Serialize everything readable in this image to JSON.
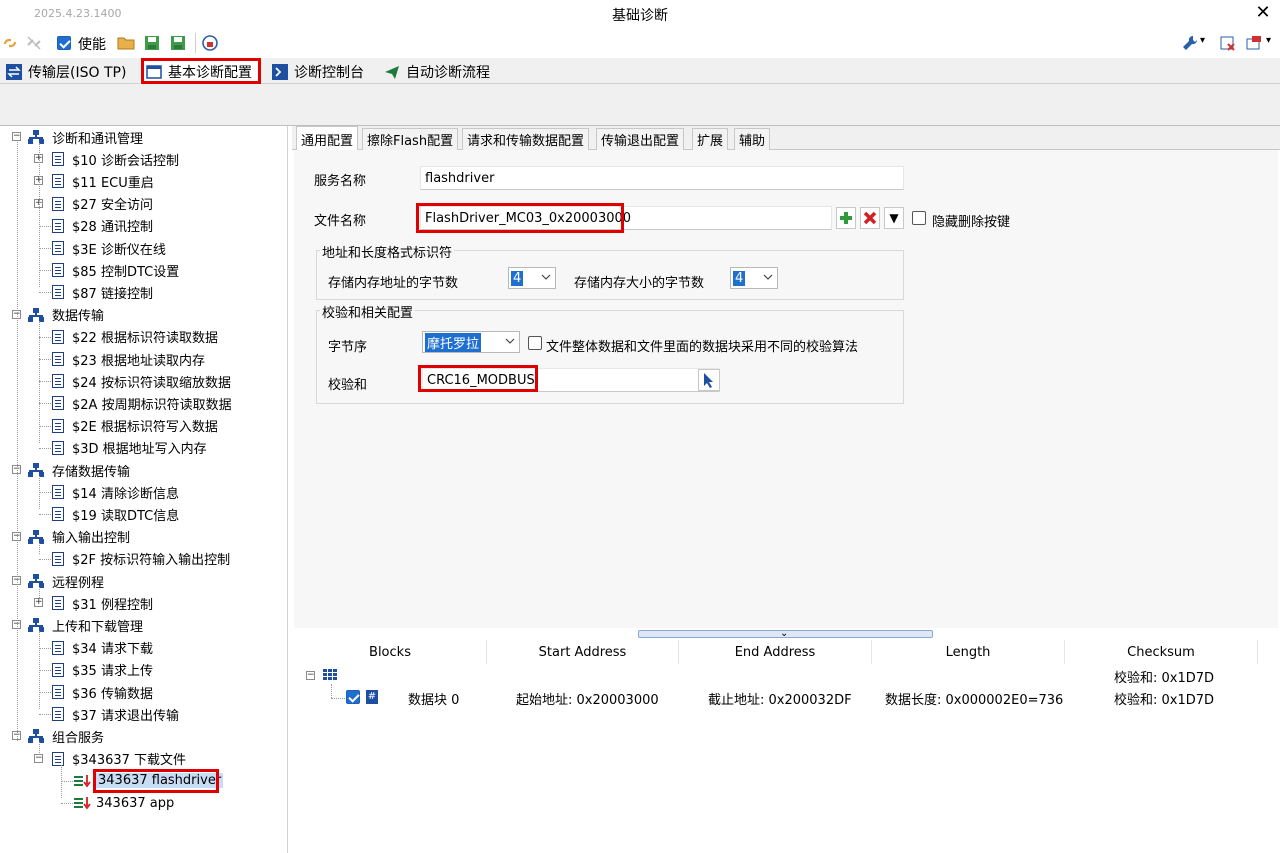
{
  "window": {
    "version": "2025.4.23.1400",
    "title": "基础诊断"
  },
  "toolbar": {
    "enable_label": "使能"
  },
  "main_tabs": [
    {
      "label": "传输层(ISO TP)"
    },
    {
      "label": "基本诊断配置"
    },
    {
      "label": "诊断控制台"
    },
    {
      "label": "自动诊断流程"
    }
  ],
  "tree": {
    "groups": [
      {
        "label": "诊断和通讯管理",
        "items": [
          "$10 诊断会话控制",
          "$11 ECU重启",
          "$27 安全访问",
          "$28 通讯控制",
          "$3E 诊断仪在线",
          "$85 控制DTC设置",
          "$87 链接控制"
        ]
      },
      {
        "label": "数据传输",
        "items": [
          "$22 根据标识符读取数据",
          "$23 根据地址读取内存",
          "$24 按标识符读取缩放数据",
          "$2A 按周期标识符读取数据",
          "$2E 根据标识符写入数据",
          "$3D 根据地址写入内存"
        ]
      },
      {
        "label": "存储数据传输",
        "items": [
          "$14 清除诊断信息",
          "$19 读取DTC信息"
        ]
      },
      {
        "label": "输入输出控制",
        "items": [
          "$2F 按标识符输入输出控制"
        ]
      },
      {
        "label": "远程例程",
        "items": [
          "$31 例程控制"
        ]
      },
      {
        "label": "上传和下载管理",
        "items": [
          "$34 请求下载",
          "$35 请求上传",
          "$36 传输数据",
          "$37 请求退出传输"
        ]
      },
      {
        "label": "组合服务",
        "items": [
          "$343637 下载文件"
        ]
      }
    ],
    "sub_items": [
      "343637 flashdriver",
      "343637 app"
    ]
  },
  "sub_tabs": [
    {
      "label": "通用配置"
    },
    {
      "label": "擦除Flash配置"
    },
    {
      "label": "请求和传输数据配置"
    },
    {
      "label": "传输退出配置"
    },
    {
      "label": "扩展"
    },
    {
      "label": "辅助"
    }
  ],
  "general": {
    "service_name_label": "服务名称",
    "service_name_value": "flashdriver",
    "file_name_label": "文件名称",
    "file_name_value": "FlashDriver_MC03_0x20003000",
    "hide_delete_label": "隐藏删除按键",
    "addr_group_title": "地址和长度格式标识符",
    "addr_bytes_label": "存储内存地址的字节数",
    "addr_bytes_value": "4",
    "size_bytes_label": "存储内存大小的字节数",
    "size_bytes_value": "4",
    "checksum_group_title": "校验和相关配置",
    "byte_order_label": "字节序",
    "byte_order_value": "摩托罗拉",
    "diff_algo_label": "文件整体数据和文件里面的数据块采用不同的校验算法",
    "checksum_label": "校验和",
    "checksum_value": "CRC16_MODBUS"
  },
  "blocks_table": {
    "headers": [
      "Blocks",
      "Start Address",
      "End Address",
      "Length",
      "Checksum"
    ],
    "summary_checksum": "校验和: 0x1D7D",
    "rows": [
      {
        "block": "数据块 0",
        "start": "起始地址: 0x20003000",
        "end": "截止地址: 0x200032DF",
        "length": "数据长度: 0x000002E0=736",
        "checksum": "校验和: 0x1D7D"
      }
    ]
  },
  "colors": {
    "highlight_red": "#e00000",
    "selection_blue": "#1e6fd0"
  }
}
